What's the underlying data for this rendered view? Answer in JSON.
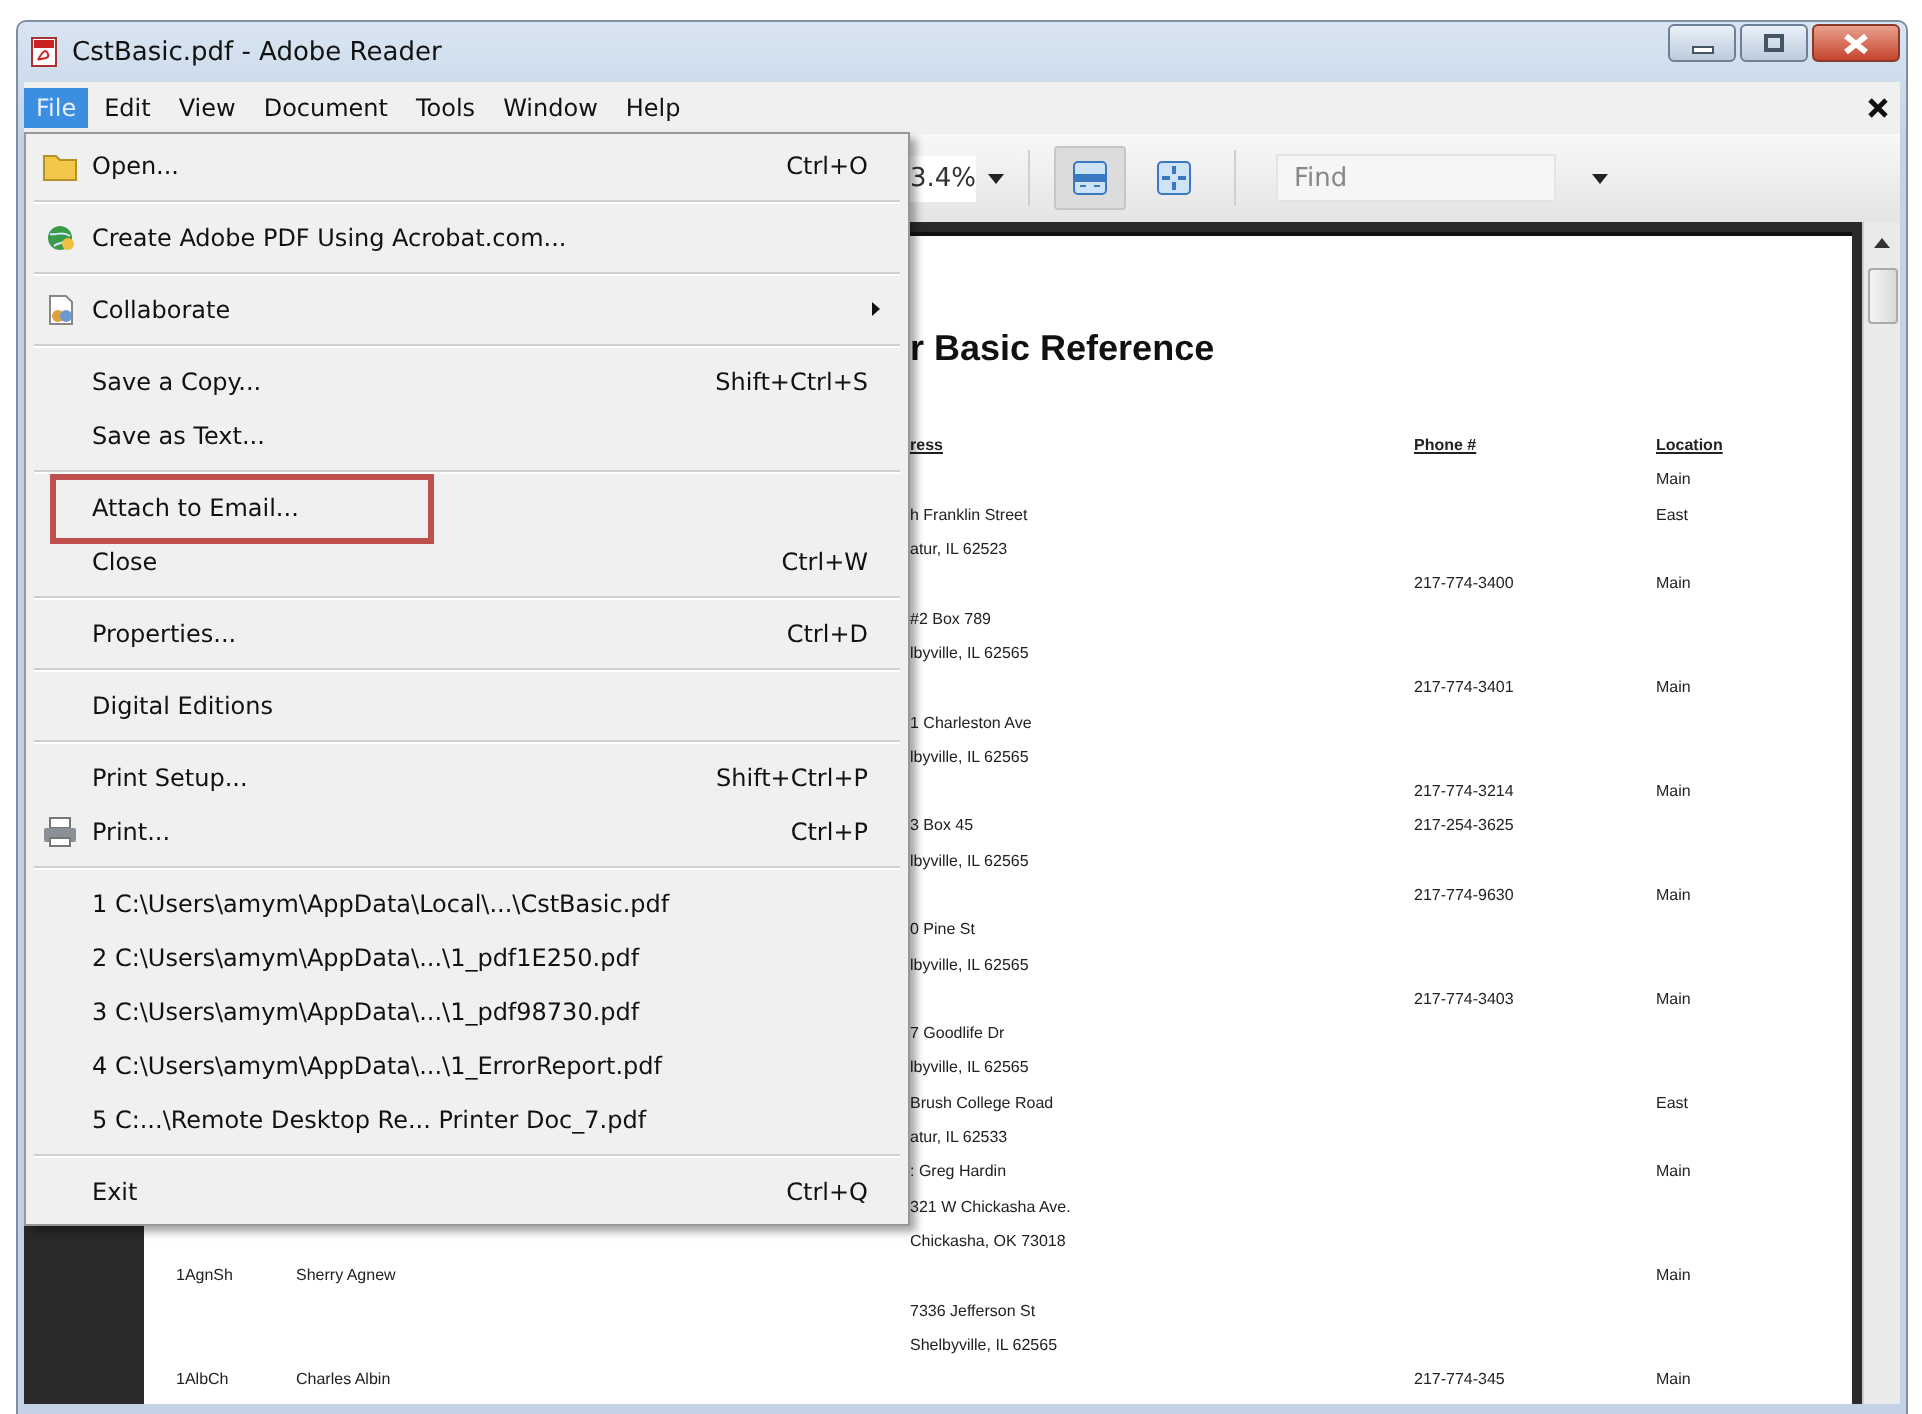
{
  "window": {
    "title": "CstBasic.pdf - Adobe Reader"
  },
  "menubar": [
    {
      "label": "File",
      "selected": true
    },
    {
      "label": "Edit",
      "selected": false
    },
    {
      "label": "View",
      "selected": false
    },
    {
      "label": "Document",
      "selected": false
    },
    {
      "label": "Tools",
      "selected": false
    },
    {
      "label": "Window",
      "selected": false
    },
    {
      "label": "Help",
      "selected": false
    }
  ],
  "toolbar": {
    "zoom": "3.4%",
    "find": {
      "placeholder": "Find"
    },
    "buttons": [
      {
        "kind": "fit-width",
        "selected": true
      },
      {
        "kind": "fit-page",
        "selected": false
      }
    ]
  },
  "menu": {
    "items": [
      {
        "kind": "item",
        "label": "Open...",
        "shortcut": "Ctrl+O"
      },
      {
        "kind": "separator"
      },
      {
        "kind": "item",
        "label": "Create Adobe PDF Using Acrobat.com..."
      },
      {
        "kind": "separator"
      },
      {
        "kind": "item",
        "label": "Collaborate",
        "submenu": true
      },
      {
        "kind": "separator"
      },
      {
        "kind": "item",
        "label": "Save a Copy...",
        "shortcut": "Shift+Ctrl+S"
      },
      {
        "kind": "item",
        "label": "Save as Text..."
      },
      {
        "kind": "separator"
      },
      {
        "kind": "item",
        "label": "Attach to Email...",
        "annotated": true
      },
      {
        "kind": "item",
        "label": "Close",
        "shortcut": "Ctrl+W"
      },
      {
        "kind": "separator"
      },
      {
        "kind": "item",
        "label": "Properties...",
        "shortcut": "Ctrl+D"
      },
      {
        "kind": "separator"
      },
      {
        "kind": "item",
        "label": "Digital Editions"
      },
      {
        "kind": "separator"
      },
      {
        "kind": "item",
        "label": "Print Setup...",
        "shortcut": "Shift+Ctrl+P"
      },
      {
        "kind": "item",
        "label": "Print...",
        "shortcut": "Ctrl+P"
      },
      {
        "kind": "separator"
      },
      {
        "kind": "item",
        "label": "1 C:\\Users\\amym\\AppData\\Local\\...\\CstBasic.pdf"
      },
      {
        "kind": "item",
        "label": "2 C:\\Users\\amym\\AppData\\...\\1_pdf1E250.pdf"
      },
      {
        "kind": "item",
        "label": "3 C:\\Users\\amym\\AppData\\...\\1_pdf98730.pdf"
      },
      {
        "kind": "item",
        "label": "4 C:\\Users\\amym\\AppData\\...\\1_ErrorReport.pdf"
      },
      {
        "kind": "item",
        "label": "5 C:...\\Remote Desktop Re... Printer Doc_7.pdf"
      },
      {
        "kind": "separator"
      },
      {
        "kind": "item",
        "label": "Exit",
        "shortcut": "Ctrl+Q"
      }
    ]
  },
  "document": {
    "title": "r Basic Reference",
    "header": {
      "address": "ress",
      "phone": "Phone #",
      "location": "Location"
    },
    "lines": [
      {
        "location": "Main"
      },
      {
        "address": "h Franklin Street",
        "location": "East"
      },
      {
        "address": "atur, IL 62523"
      },
      {
        "phone": "217-774-3400",
        "location": "Main"
      },
      {
        "address": "#2 Box 789"
      },
      {
        "address": "lbyville, IL 62565"
      },
      {
        "phone": "217-774-3401",
        "location": "Main"
      },
      {
        "address": "1 Charleston Ave"
      },
      {
        "address": "lbyville, IL 62565"
      },
      {
        "phone": "217-774-3214",
        "location": "Main"
      },
      {
        "address": "3 Box 45",
        "phone": "217-254-3625"
      },
      {
        "address": "lbyville, IL 62565"
      },
      {
        "phone": "217-774-9630",
        "location": "Main"
      },
      {
        "address": "0 Pine St"
      },
      {
        "address": "lbyville, IL 62565"
      },
      {
        "phone": "217-774-3403",
        "location": "Main"
      },
      {
        "address": "7 Goodlife Dr"
      },
      {
        "address": "lbyville, IL 62565"
      },
      {
        "address": "Brush College Road",
        "location": "East"
      },
      {
        "address": "atur, IL 62533"
      },
      {
        "address": ": Greg Hardin",
        "location": "Main"
      },
      {
        "address": "321 W Chickasha Ave."
      },
      {
        "address": "Chickasha, OK 73018"
      },
      {
        "code": "1AgnSh",
        "name": "Sherry Agnew",
        "location": "Main"
      },
      {
        "address": "7336 Jefferson St"
      },
      {
        "address": "Shelbyville, IL 62565"
      },
      {
        "code": "1AlbCh",
        "name": "Charles Albin",
        "phone": "217-774-345",
        "location": "Main"
      }
    ]
  }
}
